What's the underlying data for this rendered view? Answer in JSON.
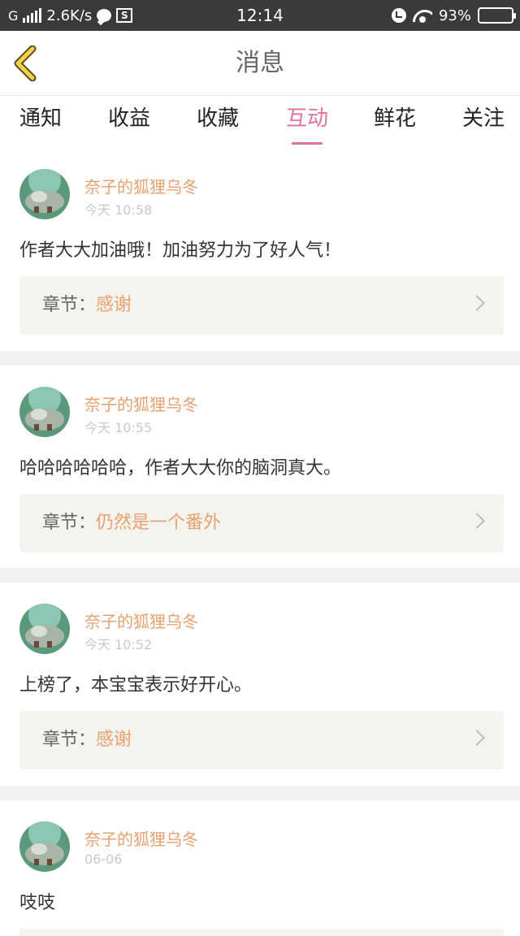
{
  "status_bar": {
    "network": "G",
    "speed": "2.6K/s",
    "time": "12:14",
    "battery": "93%",
    "battery_level": 0.93
  },
  "header": {
    "title": "消息"
  },
  "tabs": [
    {
      "label": "通知"
    },
    {
      "label": "收益"
    },
    {
      "label": "收藏"
    },
    {
      "label": "互动",
      "active": true
    },
    {
      "label": "鲜花"
    },
    {
      "label": "关注"
    }
  ],
  "messages": [
    {
      "user": "奈子的狐狸乌冬",
      "time": "今天 10:58",
      "content": "作者大大加油哦！加油努力为了好人气！",
      "chapter_label": "章节：",
      "chapter_name": "感谢"
    },
    {
      "user": "奈子的狐狸乌冬",
      "time": "今天 10:55",
      "content": "哈哈哈哈哈哈，作者大大你的脑洞真大。",
      "chapter_label": "章节：",
      "chapter_name": "仍然是一个番外"
    },
    {
      "user": "奈子的狐狸乌冬",
      "time": "今天 10:52",
      "content": "上榜了，本宝宝表示好开心。",
      "chapter_label": "章节：",
      "chapter_name": "感谢"
    },
    {
      "user": "奈子的狐狸乌冬",
      "time": "06-06",
      "content": "吱吱",
      "chapter_label": "",
      "chapter_name": ""
    }
  ],
  "colors": {
    "accent": "#e0719a",
    "username": "#e9a06f",
    "back_arrow": "#f2d24a"
  }
}
